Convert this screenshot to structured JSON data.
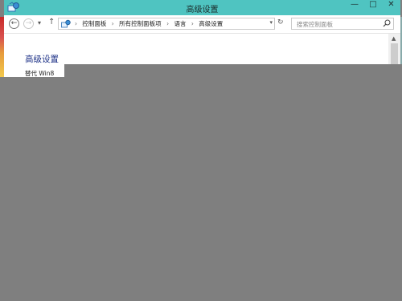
{
  "window": {
    "title": "高级设置",
    "controls": {
      "minimize": "—",
      "maximize": "□",
      "close": "✕"
    }
  },
  "navigation": {
    "back": "←",
    "forward": "→",
    "recent": "▾",
    "up": "↑",
    "breadcrumbs": [
      "控制面板",
      "所有控制面板项",
      "语言",
      "高级设置"
    ],
    "separator": "›",
    "address_dropdown": "▾",
    "refresh": "↻"
  },
  "search": {
    "placeholder": "搜索控制面板"
  },
  "content": {
    "heading": "高级设置",
    "override_label": "替代 Win8"
  },
  "colors": {
    "titlebar": "#4fc4c1",
    "heading": "#1e3287",
    "overlay": "#7f7f7f"
  },
  "icons": [
    "control-panel-icon",
    "search-icon"
  ]
}
